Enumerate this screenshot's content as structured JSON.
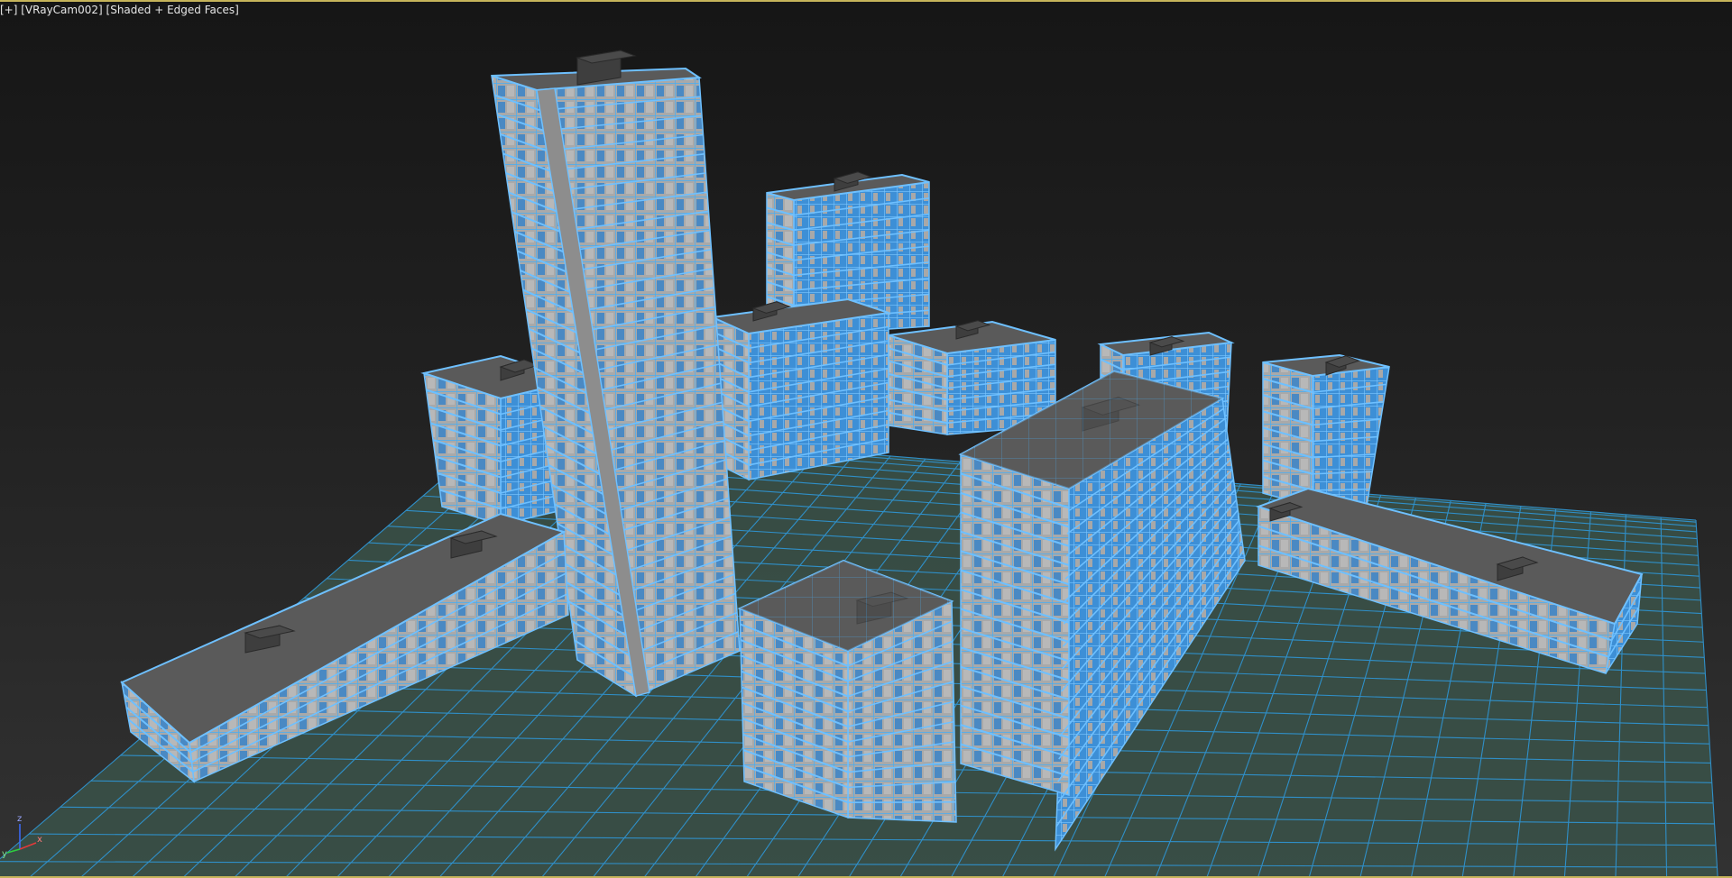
{
  "viewport": {
    "menu_plus": "[+]",
    "camera": "[VRayCam002]",
    "shading": "[Shaded + Edged Faces]"
  },
  "gizmo": {
    "x": "x",
    "y": "y",
    "z": "z"
  },
  "colors": {
    "wire": "#3da3f0",
    "wire_light": "#6ec0ff",
    "ground_wire": "#2f8fc8",
    "ground_fill": "#3a5148",
    "facade": "#aeaeae",
    "roof": "#5a5a5a",
    "roof_box": "#3e3e3e",
    "glass": "#2b7fcc",
    "viewport_border": "#c6b45a"
  }
}
